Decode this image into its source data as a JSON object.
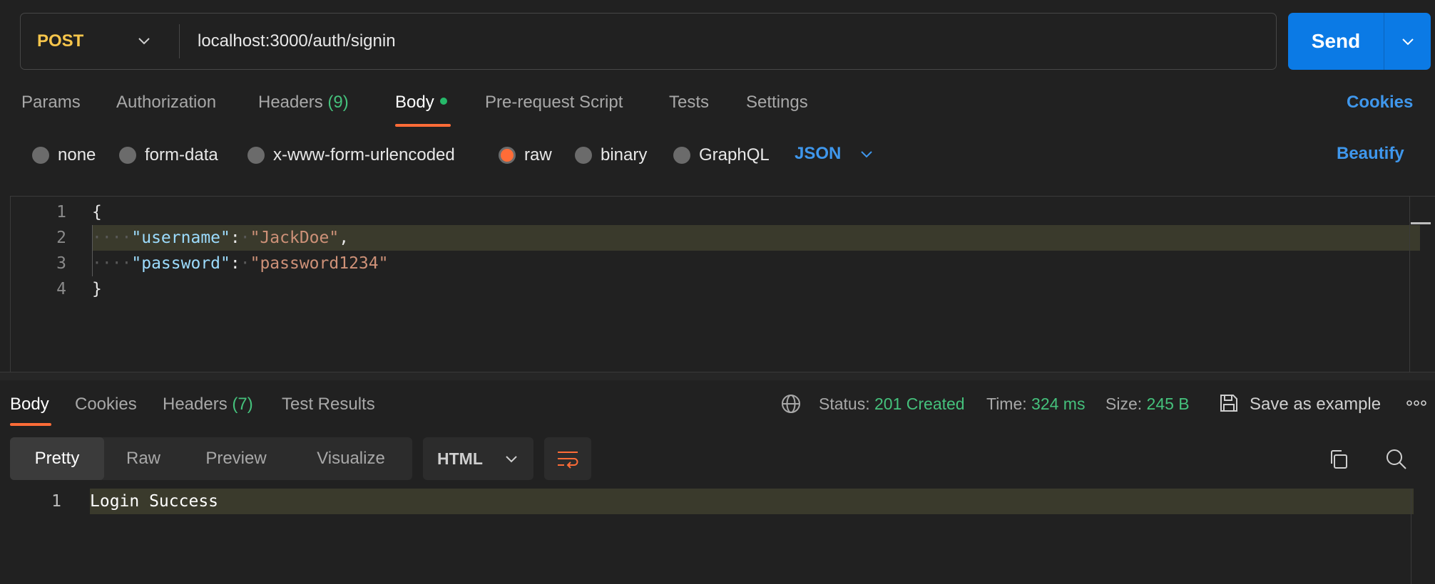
{
  "request": {
    "method": "POST",
    "url": "localhost:3000/auth/signin",
    "send_label": "Send"
  },
  "request_tabs": {
    "params": "Params",
    "authorization": "Authorization",
    "headers": "Headers",
    "headers_count": "(9)",
    "body": "Body",
    "prerequest": "Pre-request Script",
    "tests": "Tests",
    "settings": "Settings",
    "cookies": "Cookies"
  },
  "body_types": {
    "none": "none",
    "form_data": "form-data",
    "urlencoded": "x-www-form-urlencoded",
    "raw": "raw",
    "binary": "binary",
    "graphql": "GraphQL",
    "selected": "raw",
    "language": "JSON",
    "beautify": "Beautify"
  },
  "editor": {
    "line_numbers": [
      "1",
      "2",
      "3",
      "4"
    ],
    "open_brace": "{",
    "close_brace": "}",
    "key1": "\"username\"",
    "val1": "\"JackDoe\"",
    "key2": "\"password\"",
    "val2": "\"password1234\""
  },
  "response_tabs": {
    "body": "Body",
    "cookies": "Cookies",
    "headers": "Headers",
    "headers_count": "(7)",
    "test_results": "Test Results"
  },
  "response_meta": {
    "status_label": "Status:",
    "status_value": "201 Created",
    "time_label": "Time:",
    "time_value": "324 ms",
    "size_label": "Size:",
    "size_value": "245 B",
    "save_example": "Save as example"
  },
  "response_view": {
    "pretty": "Pretty",
    "raw": "Raw",
    "preview": "Preview",
    "visualize": "Visualize",
    "format": "HTML"
  },
  "response_body": {
    "line_number": "1",
    "text": "Login Success"
  },
  "colors": {
    "accent": "#ff6c37",
    "send": "#0b7ae5",
    "link": "#3f97ec",
    "success": "#45c17c",
    "method": "#f6c54b"
  }
}
